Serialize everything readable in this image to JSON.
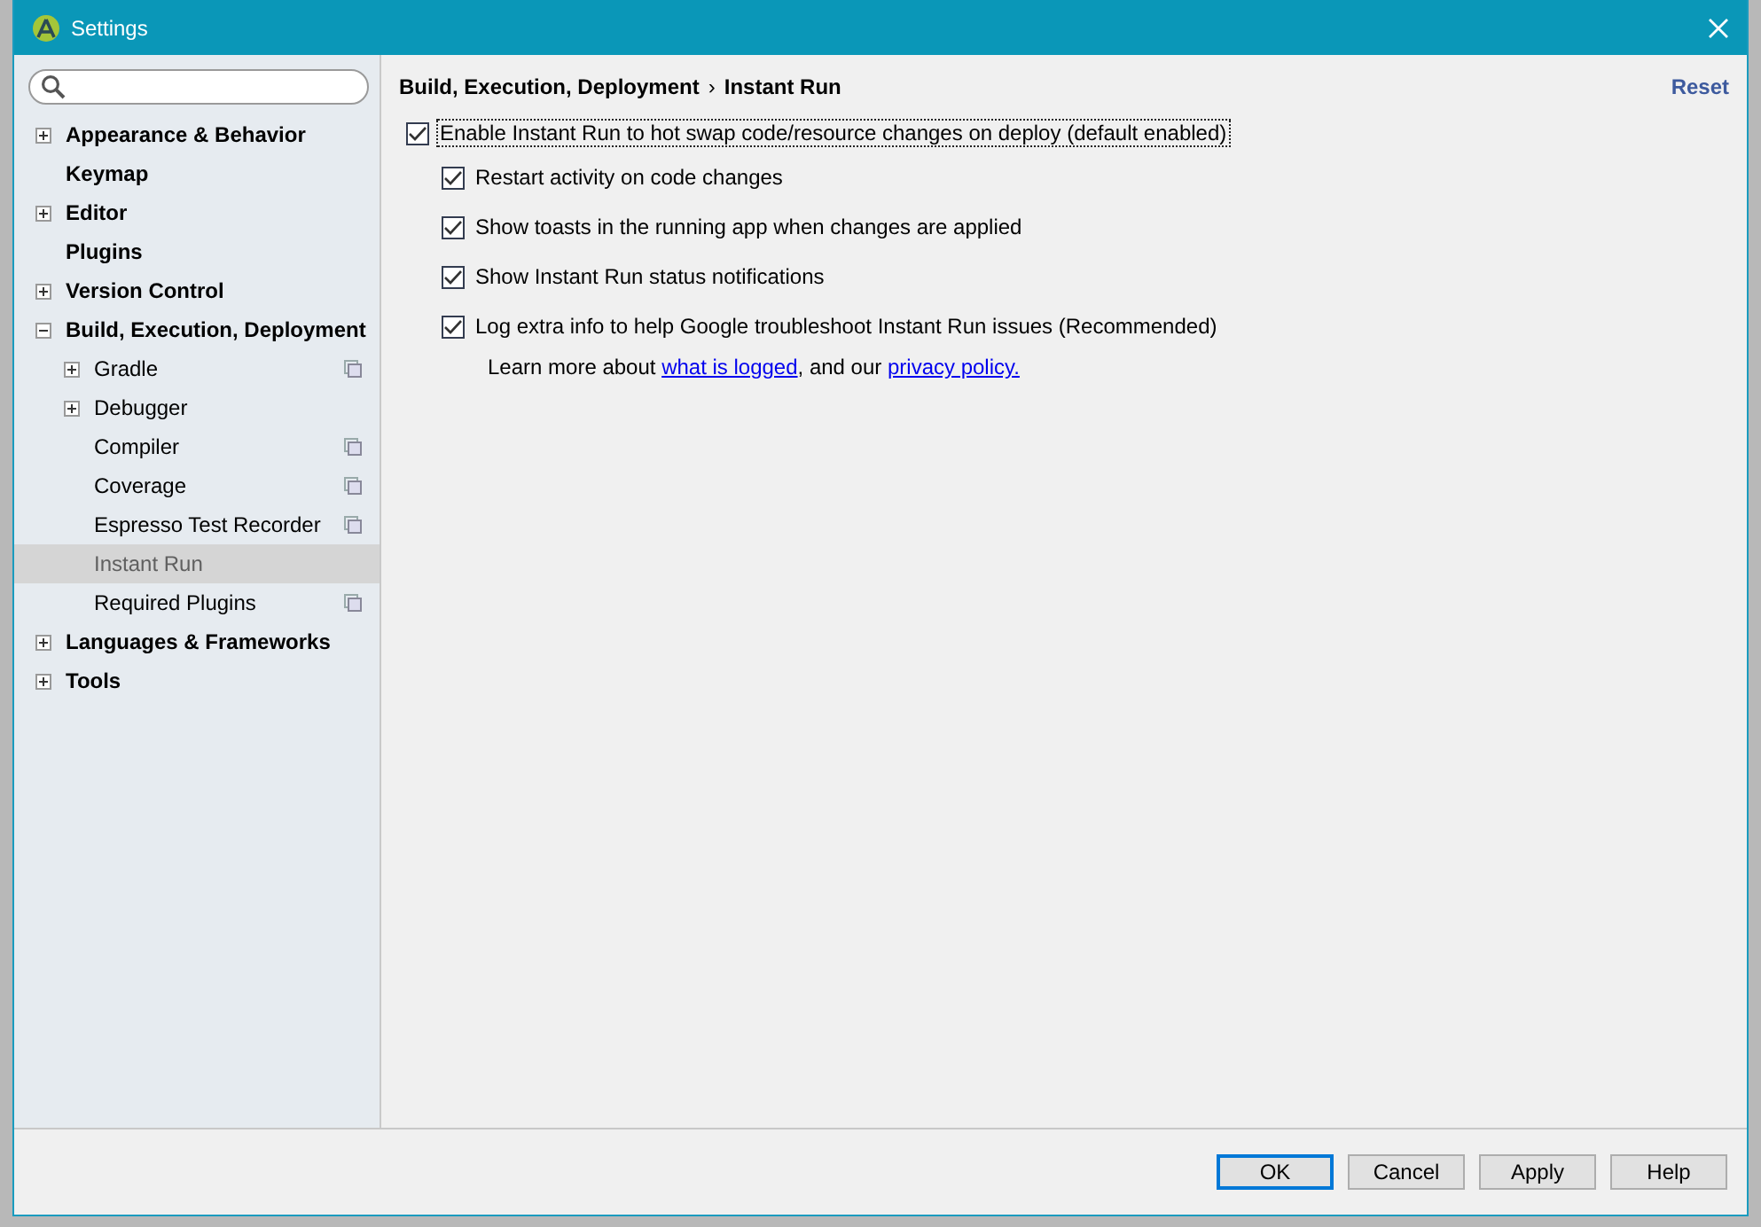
{
  "window": {
    "title": "Settings"
  },
  "sidebar": {
    "items": [
      {
        "label": "Appearance & Behavior",
        "expanded": false,
        "selected": false
      },
      {
        "label": "Keymap",
        "selected": false
      },
      {
        "label": "Editor",
        "expanded": false,
        "selected": false
      },
      {
        "label": "Plugins",
        "selected": false
      },
      {
        "label": "Version Control",
        "expanded": false,
        "selected": false
      },
      {
        "label": "Build, Execution, Deployment",
        "expanded": true,
        "selected": false,
        "children": [
          {
            "label": "Gradle",
            "expanded": false,
            "selected": false,
            "project_icon": true
          },
          {
            "label": "Debugger",
            "expanded": false,
            "selected": false,
            "project_icon": false
          },
          {
            "label": "Compiler",
            "selected": false,
            "project_icon": true
          },
          {
            "label": "Coverage",
            "selected": false,
            "project_icon": true
          },
          {
            "label": "Espresso Test Recorder",
            "selected": false,
            "project_icon": true
          },
          {
            "label": "Instant Run",
            "selected": true,
            "project_icon": false
          },
          {
            "label": "Required Plugins",
            "selected": false,
            "project_icon": true
          }
        ]
      },
      {
        "label": "Languages & Frameworks",
        "expanded": false,
        "selected": false
      },
      {
        "label": "Tools",
        "expanded": false,
        "selected": false
      }
    ]
  },
  "breadcrumb": {
    "parent": "Build, Execution, Deployment",
    "separator": "›",
    "current": "Instant Run"
  },
  "reset": "Reset",
  "options": [
    {
      "label": "Enable Instant Run to hot swap code/resource changes on deploy (default enabled)",
      "checked": true,
      "focused": true,
      "children": [
        {
          "label": "Restart activity on code changes",
          "checked": true,
          "focused": false
        },
        {
          "label": "Show toasts in the running app when changes are applied",
          "checked": true,
          "focused": false
        },
        {
          "label": "Show Instant Run status notifications",
          "checked": true,
          "focused": false
        },
        {
          "label": "Log extra info to help Google troubleshoot Instant Run issues (Recommended)",
          "checked": true,
          "focused": false
        }
      ]
    }
  ],
  "note": [
    {
      "kind": "text",
      "text": "Learn more about "
    },
    {
      "kind": "link",
      "text": "what is logged"
    },
    {
      "kind": "text",
      "text": ", and our "
    },
    {
      "kind": "link",
      "text": "privacy policy."
    }
  ],
  "buttons": [
    {
      "label": "OK",
      "default": true
    },
    {
      "label": "Cancel",
      "default": false
    },
    {
      "label": "Apply",
      "default": false
    },
    {
      "label": "Help",
      "default": false
    }
  ]
}
